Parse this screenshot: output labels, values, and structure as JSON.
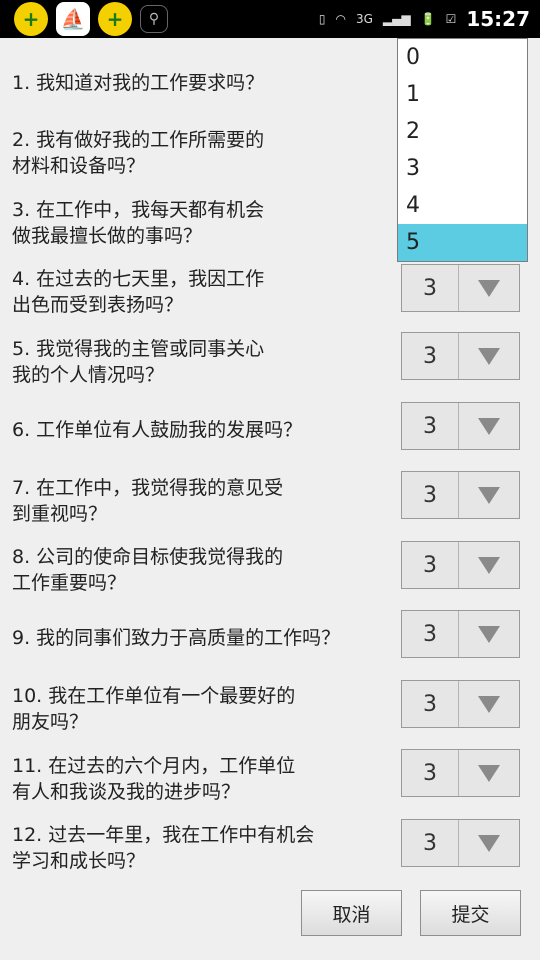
{
  "status_bar": {
    "icons": [
      "360-security-icon",
      "translate-app-icon",
      "360-plus-icon",
      "usb-icon",
      "vibrate-icon",
      "wifi-icon",
      "3g-icon",
      "signal-icon",
      "battery-charging-icon",
      "clipboard-icon"
    ],
    "network_label": "3G",
    "time": "15:27"
  },
  "questions": [
    {
      "text": "1. 我知道对我的工作要求吗？"
    },
    {
      "text": "2. 我有做好我的工作所需要的\n材料和设备吗？"
    },
    {
      "text": "3. 在工作中，我每天都有机会\n做我最擅长做的事吗？"
    },
    {
      "text": "4. 在过去的七天里，我因工作\n出色而受到表扬吗？",
      "value": "3"
    },
    {
      "text": "5. 我觉得我的主管或同事关心\n我的个人情况吗？",
      "value": "3"
    },
    {
      "text": "6. 工作单位有人鼓励我的发展吗？",
      "value": "3"
    },
    {
      "text": "7. 在工作中，我觉得我的意见受\n到重视吗？",
      "value": "3"
    },
    {
      "text": "8. 公司的使命目标使我觉得我的\n工作重要吗？",
      "value": "3"
    },
    {
      "text": "9. 我的同事们致力于高质量的工作吗？",
      "value": "3"
    },
    {
      "text": "10. 我在工作单位有一个最要好的\n朋友吗？",
      "value": "3"
    },
    {
      "text": "11. 在过去的六个月内，工作单位\n有人和我谈及我的进步吗？",
      "value": "3"
    },
    {
      "text": "12. 过去一年里，我在工作中有机会\n学习和成长吗？",
      "value": "3"
    }
  ],
  "dropdown": {
    "options": [
      "0",
      "1",
      "2",
      "3",
      "4",
      "5"
    ],
    "selected_index": 5,
    "highlight_color": "#5ccce3"
  },
  "buttons": {
    "cancel": "取消",
    "submit": "提交"
  }
}
